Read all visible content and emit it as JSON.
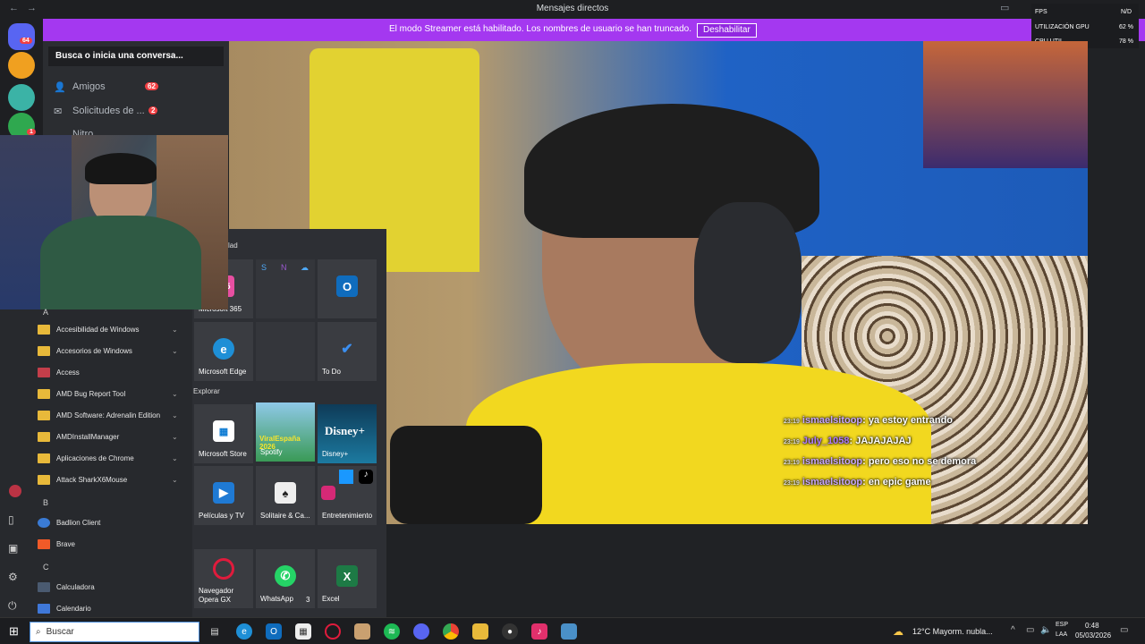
{
  "window": {
    "title": "Mensajes directos"
  },
  "banner": {
    "message": "El modo Streamer está habilitado. Los nombres de usuario se han truncado.",
    "button": "Deshabilitar"
  },
  "rail": {
    "badge_count": "64",
    "badge_small": "1"
  },
  "dm": {
    "search_placeholder": "Busca o inicia una conversa...",
    "items": [
      {
        "label": "Amigos",
        "badge": "62"
      },
      {
        "label": "Solicitudes de ...",
        "badge": "2"
      },
      {
        "label": "Nitro"
      }
    ]
  },
  "overlay": {
    "fps_label": "FPS",
    "fps_value": "N/D",
    "gpu_label": "UTILIZACIÓN GPU",
    "gpu_value": "62 %",
    "cpu_label": "CPU UTIL",
    "cpu_value": "78 %"
  },
  "chat": [
    {
      "user": "ismaelsitoop",
      "text": ": ya estoy entrando",
      "user_color": "#c7a6ff"
    },
    {
      "user": "July_1058",
      "text": ": JAJAJAJAJ",
      "user_color": "#b07cff"
    },
    {
      "user": "ismaelsitoop",
      "text": ": pero eso no se demora",
      "user_color": "#c7a6ff"
    },
    {
      "user": "ismaelsitoop",
      "text": ": en epic game",
      "user_color": "#c7a6ff"
    }
  ],
  "startmenu": {
    "section_header": "lad",
    "explore_header": "Explorar",
    "letter_a": "A",
    "letter_b": "B",
    "letter_c": "C",
    "apps_a": [
      {
        "label": "Accesibilidad de Windows",
        "folder": true
      },
      {
        "label": "Accesorios de Windows",
        "folder": true
      },
      {
        "label": "Access",
        "folder": false,
        "color": "#c43e4a"
      },
      {
        "label": "AMD Bug Report Tool",
        "folder": true
      },
      {
        "label": "AMD Software: Adrenalin Edition",
        "folder": true
      },
      {
        "label": "AMDInstallManager",
        "folder": true
      },
      {
        "label": "Aplicaciones de Chrome",
        "folder": true
      },
      {
        "label": "Attack SharkX6Mouse",
        "folder": true
      }
    ],
    "apps_b": [
      {
        "label": "Badlion Client",
        "color": "#3a7bd5"
      },
      {
        "label": "Brave",
        "color": "#f05a28"
      }
    ],
    "apps_c": [
      {
        "label": "Calculadora",
        "color": "#4a5a70"
      },
      {
        "label": "Calendario",
        "color": "#3f78d9"
      }
    ],
    "tiles": {
      "m365": "Microsoft 365",
      "m365_glyph": "365",
      "outlook": "O",
      "edge": "Microsoft Edge",
      "todo": "To Do",
      "store": "Microsoft Store",
      "spotify": "Spotify",
      "spotify_art": "ViralEspaña 2026",
      "disney": "Disney+",
      "peliculas": "Películas y TV",
      "solitaire": "Solitaire & Ca...",
      "entretenimiento": "Entretenimiento",
      "opera": "Navegador Opera GX",
      "whatsapp": "WhatsApp",
      "whatsapp_badge": "3",
      "excel": "Excel"
    }
  },
  "taskbar": {
    "search_placeholder": "Buscar",
    "weather": "12°C  Mayorm. nubla...",
    "lang1": "ESP",
    "lang2": "LAA",
    "time": "0:48",
    "date": "05/03/2026"
  },
  "colors": {
    "discord_blurple": "#5865f2",
    "streamer_banner": "#a438f0",
    "notif_red": "#f23f43"
  }
}
